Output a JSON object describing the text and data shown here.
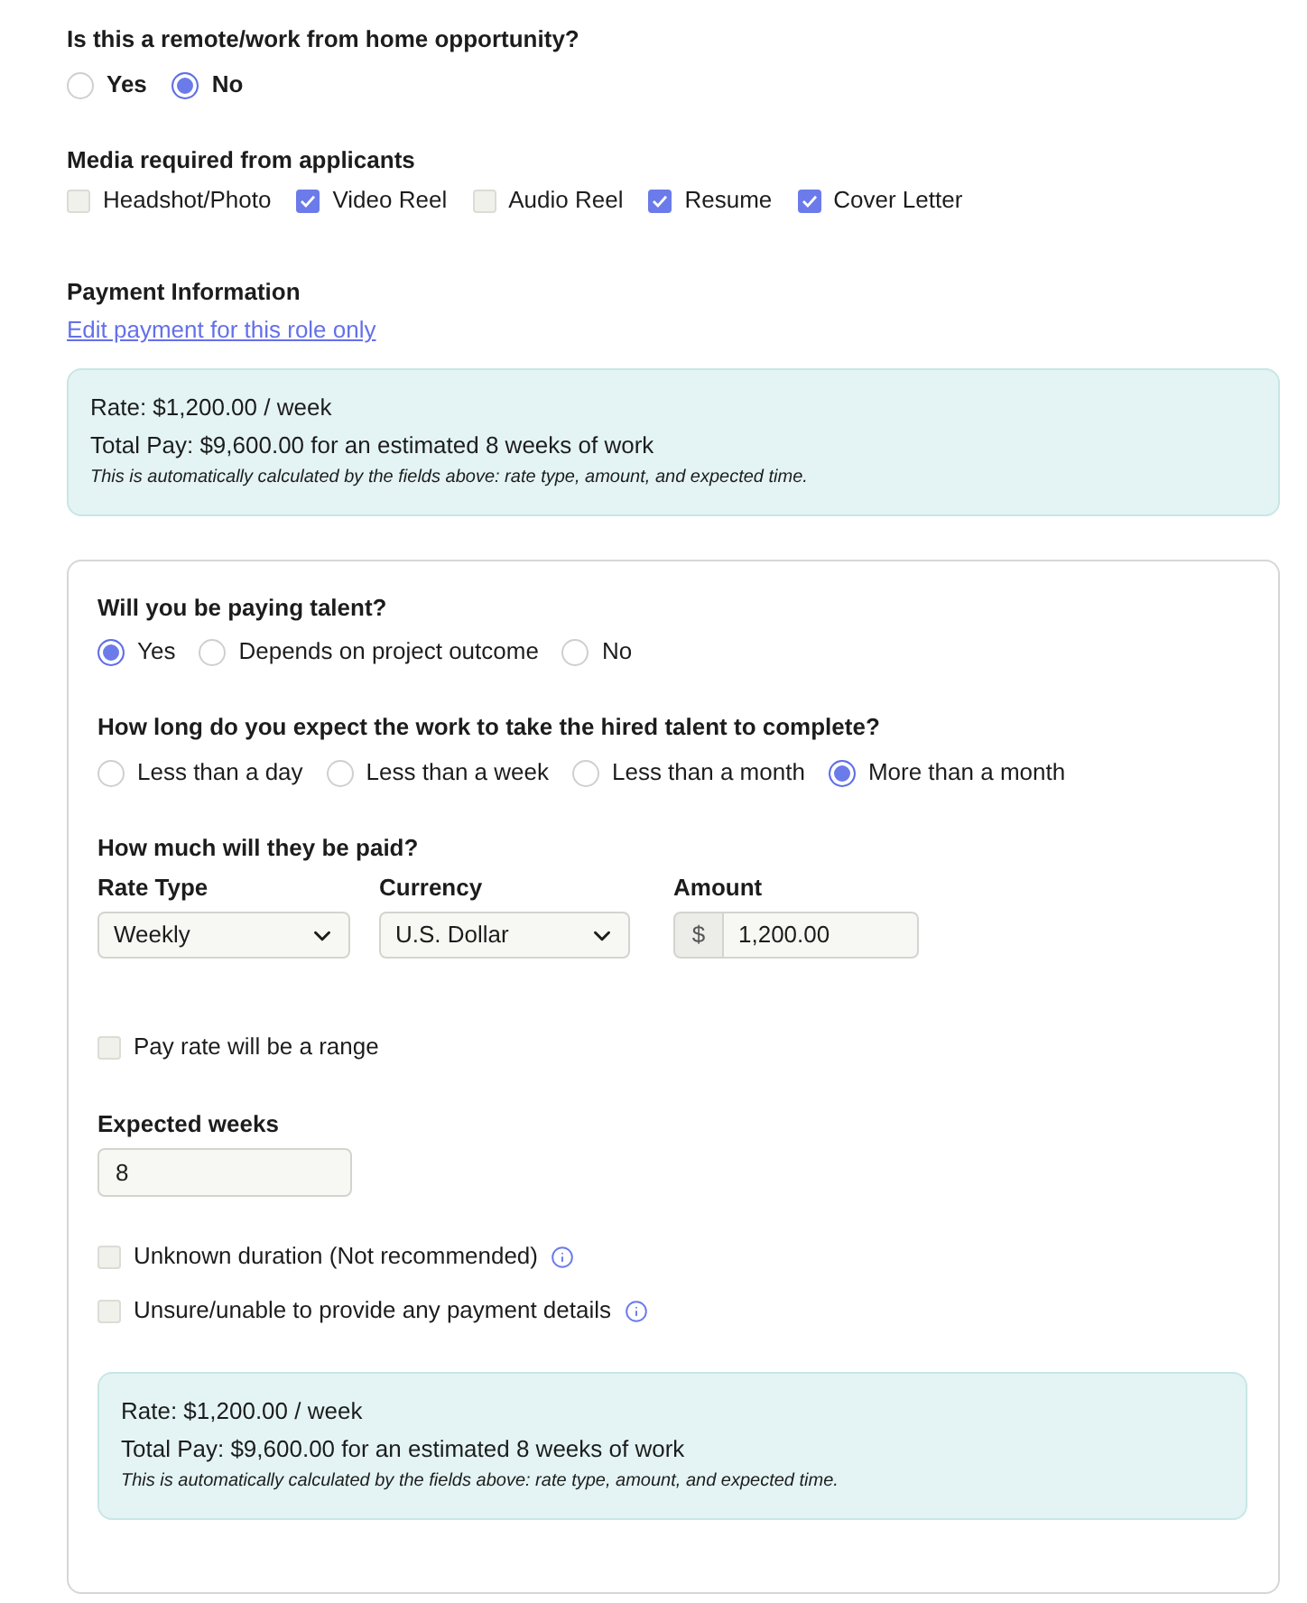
{
  "remote_question": {
    "label": "Is this a remote/work from home opportunity?",
    "options": [
      {
        "label": "Yes",
        "selected": false
      },
      {
        "label": "No",
        "selected": true
      }
    ]
  },
  "media": {
    "label": "Media required from applicants",
    "options": [
      {
        "label": "Headshot/Photo",
        "checked": false
      },
      {
        "label": "Video Reel",
        "checked": true
      },
      {
        "label": "Audio Reel",
        "checked": false
      },
      {
        "label": "Resume",
        "checked": true
      },
      {
        "label": "Cover Letter",
        "checked": true
      }
    ]
  },
  "payment": {
    "title": "Payment Information",
    "link": "Edit payment for this role only",
    "summary": {
      "rate": "Rate: $1,200.00 / week",
      "total": "Total Pay: $9,600.00 for an estimated 8 weeks of work",
      "note": "This is automatically calculated by the fields above: rate type, amount, and expected time."
    }
  },
  "card": {
    "paying_question": {
      "label": "Will you be paying talent?",
      "options": [
        {
          "label": "Yes",
          "selected": true
        },
        {
          "label": "Depends on project outcome",
          "selected": false
        },
        {
          "label": "No",
          "selected": false
        }
      ]
    },
    "duration_question": {
      "label": "How long do you expect the work to take the hired talent to complete?",
      "options": [
        {
          "label": "Less than a day",
          "selected": false
        },
        {
          "label": "Less than a week",
          "selected": false
        },
        {
          "label": "Less than a month",
          "selected": false
        },
        {
          "label": "More than a month",
          "selected": true
        }
      ]
    },
    "pay": {
      "label": "How much will they be paid?",
      "rate_type": {
        "label": "Rate Type",
        "value": "Weekly"
      },
      "currency": {
        "label": "Currency",
        "value": "U.S. Dollar"
      },
      "amount": {
        "label": "Amount",
        "prefix": "$",
        "value": "1,200.00"
      }
    },
    "range_checkbox": {
      "label": "Pay rate will be a range",
      "checked": false
    },
    "expected_weeks": {
      "label": "Expected weeks",
      "value": "8"
    },
    "options": [
      {
        "label": "Unknown duration (Not recommended)",
        "checked": false,
        "info": true
      },
      {
        "label": "Unsure/unable to provide any payment details",
        "checked": false,
        "info": true
      }
    ],
    "summary": {
      "rate": "Rate: $1,200.00 / week",
      "total": "Total Pay: $9,600.00 for an estimated 8 weeks of work",
      "note": "This is automatically calculated by the fields above: rate type, amount, and expected time."
    }
  }
}
